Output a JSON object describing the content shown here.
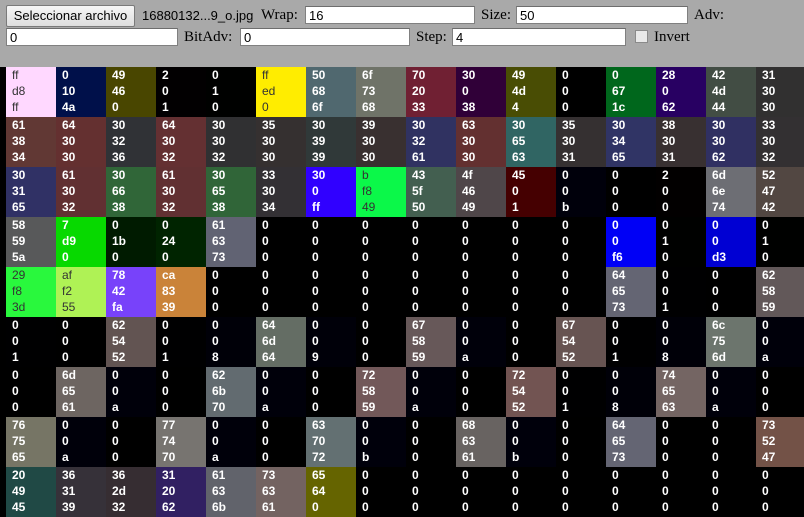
{
  "toolbar": {
    "file_button": "Seleccionar archivo",
    "file_name": "16880132...9_o.jpg",
    "wrap_label": "Wrap:",
    "wrap_value": "16",
    "size_label": "Size:",
    "size_value": "50",
    "adv_label": "Adv:",
    "adv_value": "0",
    "bitadv_label": "BitAdv:",
    "bitadv_value": "0",
    "step_label": "Step:",
    "step_value": "4",
    "invert_label": "Invert",
    "invert_checked": false
  },
  "grid": {
    "columns": 16,
    "cells": [
      {
        "r": "ff",
        "g": "d8",
        "b": "ff",
        "bg": "#ffd8ff"
      },
      {
        "r": "0",
        "g": "10",
        "b": "4a",
        "bg": "#00104a"
      },
      {
        "r": "49",
        "g": "46",
        "b": "0",
        "bg": "#494600"
      },
      {
        "r": "2",
        "g": "0",
        "b": "1",
        "bg": "#020001"
      },
      {
        "r": "0",
        "g": "1",
        "b": "0",
        "bg": "#000100"
      },
      {
        "r": "ff",
        "g": "ed",
        "b": "0",
        "bg": "#ffed00"
      },
      {
        "r": "50",
        "g": "68",
        "b": "6f",
        "bg": "#50686f"
      },
      {
        "r": "6f",
        "g": "73",
        "b": "68",
        "bg": "#6f7368"
      },
      {
        "r": "70",
        "g": "20",
        "b": "33",
        "bg": "#702033"
      },
      {
        "r": "30",
        "g": "0",
        "b": "38",
        "bg": "#300038"
      },
      {
        "r": "49",
        "g": "4d",
        "b": "4",
        "bg": "#494d04"
      },
      {
        "r": "0",
        "g": "0",
        "b": "0",
        "bg": "#000000"
      },
      {
        "r": "0",
        "g": "67",
        "b": "1c",
        "bg": "#00671c"
      },
      {
        "r": "28",
        "g": "0",
        "b": "62",
        "bg": "#280062"
      },
      {
        "r": "42",
        "g": "4d",
        "b": "44",
        "bg": "#424d44"
      },
      {
        "r": "31",
        "g": "30",
        "b": "30",
        "bg": "#313030"
      },
      {
        "r": "61",
        "g": "38",
        "b": "34",
        "bg": "#613834"
      },
      {
        "r": "64",
        "g": "30",
        "b": "30",
        "bg": "#643030"
      },
      {
        "r": "30",
        "g": "32",
        "b": "36",
        "bg": "#303236"
      },
      {
        "r": "64",
        "g": "30",
        "b": "32",
        "bg": "#643032"
      },
      {
        "r": "30",
        "g": "30",
        "b": "32",
        "bg": "#303032"
      },
      {
        "r": "35",
        "g": "30",
        "b": "30",
        "bg": "#353030"
      },
      {
        "r": "30",
        "g": "39",
        "b": "39",
        "bg": "#303939"
      },
      {
        "r": "39",
        "g": "30",
        "b": "30",
        "bg": "#393030"
      },
      {
        "r": "30",
        "g": "32",
        "b": "61",
        "bg": "#303261"
      },
      {
        "r": "63",
        "g": "30",
        "b": "30",
        "bg": "#633030"
      },
      {
        "r": "30",
        "g": "65",
        "b": "63",
        "bg": "#306563"
      },
      {
        "r": "35",
        "g": "30",
        "b": "31",
        "bg": "#353031"
      },
      {
        "r": "30",
        "g": "34",
        "b": "65",
        "bg": "#303465"
      },
      {
        "r": "38",
        "g": "30",
        "b": "31",
        "bg": "#383031"
      },
      {
        "r": "30",
        "g": "30",
        "b": "62",
        "bg": "#303062"
      },
      {
        "r": "33",
        "g": "30",
        "b": "32",
        "bg": "#333032"
      },
      {
        "r": "30",
        "g": "31",
        "b": "65",
        "bg": "#303165"
      },
      {
        "r": "61",
        "g": "30",
        "b": "32",
        "bg": "#613032"
      },
      {
        "r": "30",
        "g": "66",
        "b": "38",
        "bg": "#306638"
      },
      {
        "r": "61",
        "g": "30",
        "b": "32",
        "bg": "#613032"
      },
      {
        "r": "30",
        "g": "65",
        "b": "38",
        "bg": "#306538"
      },
      {
        "r": "33",
        "g": "30",
        "b": "34",
        "bg": "#333034"
      },
      {
        "r": "30",
        "g": "0",
        "b": "ff",
        "bg": "#3000ff"
      },
      {
        "r": "b",
        "g": "f8",
        "b": "49",
        "bg": "#0bf849"
      },
      {
        "r": "43",
        "g": "5f",
        "b": "50",
        "bg": "#435f50"
      },
      {
        "r": "4f",
        "g": "46",
        "b": "49",
        "bg": "#4f4649"
      },
      {
        "r": "45",
        "g": "0",
        "b": "1",
        "bg": "#450001"
      },
      {
        "r": "0",
        "g": "0",
        "b": "b",
        "bg": "#00000b"
      },
      {
        "r": "0",
        "g": "0",
        "b": "0",
        "bg": "#000000"
      },
      {
        "r": "2",
        "g": "0",
        "b": "0",
        "bg": "#020000"
      },
      {
        "r": "6d",
        "g": "6e",
        "b": "74",
        "bg": "#6d6e74"
      },
      {
        "r": "52",
        "g": "47",
        "b": "42",
        "bg": "#524742"
      },
      {
        "r": "58",
        "g": "59",
        "b": "5a",
        "bg": "#58595a"
      },
      {
        "r": "7",
        "g": "d9",
        "b": "0",
        "bg": "#07d900"
      },
      {
        "r": "0",
        "g": "1b",
        "b": "0",
        "bg": "#001b00"
      },
      {
        "r": "0",
        "g": "24",
        "b": "0",
        "bg": "#002400"
      },
      {
        "r": "61",
        "g": "63",
        "b": "73",
        "bg": "#616373"
      },
      {
        "r": "0",
        "g": "0",
        "b": "0",
        "bg": "#000000"
      },
      {
        "r": "0",
        "g": "0",
        "b": "0",
        "bg": "#000000"
      },
      {
        "r": "0",
        "g": "0",
        "b": "0",
        "bg": "#000000"
      },
      {
        "r": "0",
        "g": "0",
        "b": "0",
        "bg": "#000000"
      },
      {
        "r": "0",
        "g": "0",
        "b": "0",
        "bg": "#000000"
      },
      {
        "r": "0",
        "g": "0",
        "b": "0",
        "bg": "#000000"
      },
      {
        "r": "0",
        "g": "0",
        "b": "0",
        "bg": "#000000"
      },
      {
        "r": "0",
        "g": "0",
        "b": "f6",
        "bg": "#0000f6"
      },
      {
        "r": "0",
        "g": "1",
        "b": "0",
        "bg": "#000100"
      },
      {
        "r": "0",
        "g": "0",
        "b": "d3",
        "bg": "#0000d3"
      },
      {
        "r": "0",
        "g": "1",
        "b": "0",
        "bg": "#000100"
      },
      {
        "r": "29",
        "g": "f8",
        "b": "3d",
        "bg": "#29f83d"
      },
      {
        "r": "af",
        "g": "f2",
        "b": "55",
        "bg": "#aff255"
      },
      {
        "r": "78",
        "g": "42",
        "b": "fa",
        "bg": "#7842fa"
      },
      {
        "r": "ca",
        "g": "83",
        "b": "39",
        "bg": "#ca8339"
      },
      {
        "r": "0",
        "g": "0",
        "b": "0",
        "bg": "#000000"
      },
      {
        "r": "0",
        "g": "0",
        "b": "0",
        "bg": "#000000"
      },
      {
        "r": "0",
        "g": "0",
        "b": "0",
        "bg": "#000000"
      },
      {
        "r": "0",
        "g": "0",
        "b": "0",
        "bg": "#000000"
      },
      {
        "r": "0",
        "g": "0",
        "b": "0",
        "bg": "#000000"
      },
      {
        "r": "0",
        "g": "0",
        "b": "0",
        "bg": "#000000"
      },
      {
        "r": "0",
        "g": "0",
        "b": "0",
        "bg": "#000000"
      },
      {
        "r": "0",
        "g": "0",
        "b": "0",
        "bg": "#000000"
      },
      {
        "r": "64",
        "g": "65",
        "b": "73",
        "bg": "#646573"
      },
      {
        "r": "0",
        "g": "0",
        "b": "1",
        "bg": "#000001"
      },
      {
        "r": "0",
        "g": "0",
        "b": "0",
        "bg": "#000000"
      },
      {
        "r": "62",
        "g": "58",
        "b": "59",
        "bg": "#625859"
      },
      {
        "r": "0",
        "g": "0",
        "b": "1",
        "bg": "#000001"
      },
      {
        "r": "0",
        "g": "0",
        "b": "0",
        "bg": "#000000"
      },
      {
        "r": "62",
        "g": "54",
        "b": "52",
        "bg": "#625452"
      },
      {
        "r": "0",
        "g": "0",
        "b": "1",
        "bg": "#000001"
      },
      {
        "r": "0",
        "g": "0",
        "b": "8",
        "bg": "#000008"
      },
      {
        "r": "64",
        "g": "6d",
        "b": "64",
        "bg": "#646d64"
      },
      {
        "r": "0",
        "g": "0",
        "b": "9",
        "bg": "#000009"
      },
      {
        "r": "0",
        "g": "0",
        "b": "0",
        "bg": "#000000"
      },
      {
        "r": "67",
        "g": "58",
        "b": "59",
        "bg": "#675859"
      },
      {
        "r": "0",
        "g": "0",
        "b": "a",
        "bg": "#00000a"
      },
      {
        "r": "0",
        "g": "0",
        "b": "0",
        "bg": "#000000"
      },
      {
        "r": "67",
        "g": "54",
        "b": "52",
        "bg": "#675452"
      },
      {
        "r": "0",
        "g": "0",
        "b": "1",
        "bg": "#000001"
      },
      {
        "r": "0",
        "g": "0",
        "b": "8",
        "bg": "#000008"
      },
      {
        "r": "6c",
        "g": "75",
        "b": "6d",
        "bg": "#6c756d"
      },
      {
        "r": "0",
        "g": "0",
        "b": "a",
        "bg": "#00000a"
      },
      {
        "r": "0",
        "g": "0",
        "b": "0",
        "bg": "#000000"
      },
      {
        "r": "6d",
        "g": "65",
        "b": "61",
        "bg": "#6d6561"
      },
      {
        "r": "0",
        "g": "0",
        "b": "a",
        "bg": "#00000a"
      },
      {
        "r": "0",
        "g": "0",
        "b": "0",
        "bg": "#000000"
      },
      {
        "r": "62",
        "g": "6b",
        "b": "70",
        "bg": "#626b70"
      },
      {
        "r": "0",
        "g": "0",
        "b": "a",
        "bg": "#00000a"
      },
      {
        "r": "0",
        "g": "0",
        "b": "0",
        "bg": "#000000"
      },
      {
        "r": "72",
        "g": "58",
        "b": "59",
        "bg": "#725859"
      },
      {
        "r": "0",
        "g": "0",
        "b": "a",
        "bg": "#00000a"
      },
      {
        "r": "0",
        "g": "0",
        "b": "0",
        "bg": "#000000"
      },
      {
        "r": "72",
        "g": "54",
        "b": "52",
        "bg": "#725452"
      },
      {
        "r": "0",
        "g": "0",
        "b": "1",
        "bg": "#000001"
      },
      {
        "r": "0",
        "g": "0",
        "b": "8",
        "bg": "#000008"
      },
      {
        "r": "74",
        "g": "65",
        "b": "63",
        "bg": "#746563"
      },
      {
        "r": "0",
        "g": "0",
        "b": "a",
        "bg": "#00000a"
      },
      {
        "r": "0",
        "g": "0",
        "b": "0",
        "bg": "#000000"
      },
      {
        "r": "76",
        "g": "75",
        "b": "65",
        "bg": "#767565"
      },
      {
        "r": "0",
        "g": "0",
        "b": "a",
        "bg": "#00000a"
      },
      {
        "r": "0",
        "g": "0",
        "b": "0",
        "bg": "#000000"
      },
      {
        "r": "77",
        "g": "74",
        "b": "70",
        "bg": "#777470"
      },
      {
        "r": "0",
        "g": "0",
        "b": "a",
        "bg": "#00000a"
      },
      {
        "r": "0",
        "g": "0",
        "b": "0",
        "bg": "#000000"
      },
      {
        "r": "63",
        "g": "70",
        "b": "72",
        "bg": "#637072"
      },
      {
        "r": "0",
        "g": "0",
        "b": "b",
        "bg": "#00000b"
      },
      {
        "r": "0",
        "g": "0",
        "b": "0",
        "bg": "#000000"
      },
      {
        "r": "68",
        "g": "63",
        "b": "61",
        "bg": "#686361"
      },
      {
        "r": "0",
        "g": "0",
        "b": "b",
        "bg": "#00000b"
      },
      {
        "r": "0",
        "g": "0",
        "b": "0",
        "bg": "#000000"
      },
      {
        "r": "64",
        "g": "65",
        "b": "73",
        "bg": "#646573"
      },
      {
        "r": "0",
        "g": "0",
        "b": "0",
        "bg": "#000000"
      },
      {
        "r": "0",
        "g": "0",
        "b": "0",
        "bg": "#000000"
      },
      {
        "r": "73",
        "g": "52",
        "b": "47",
        "bg": "#735247"
      },
      {
        "r": "20",
        "g": "49",
        "b": "45",
        "bg": "#204945"
      },
      {
        "r": "36",
        "g": "31",
        "b": "39",
        "bg": "#363139"
      },
      {
        "r": "36",
        "g": "2d",
        "b": "32",
        "bg": "#362d32"
      },
      {
        "r": "31",
        "g": "20",
        "b": "62",
        "bg": "#312062"
      },
      {
        "r": "61",
        "g": "63",
        "b": "6b",
        "bg": "#61636b"
      },
      {
        "r": "73",
        "g": "63",
        "b": "61",
        "bg": "#736361"
      },
      {
        "r": "65",
        "g": "64",
        "b": "0",
        "bg": "#656400"
      },
      {
        "r": "0",
        "g": "0",
        "b": "0",
        "bg": "#000000"
      },
      {
        "r": "0",
        "g": "0",
        "b": "0",
        "bg": "#000000"
      },
      {
        "r": "0",
        "g": "0",
        "b": "0",
        "bg": "#000000"
      },
      {
        "r": "0",
        "g": "0",
        "b": "0",
        "bg": "#000000"
      },
      {
        "r": "0",
        "g": "0",
        "b": "0",
        "bg": "#000000"
      },
      {
        "r": "0",
        "g": "0",
        "b": "0",
        "bg": "#000000"
      },
      {
        "r": "0",
        "g": "0",
        "b": "0",
        "bg": "#000000"
      },
      {
        "r": "0",
        "g": "0",
        "b": "0",
        "bg": "#000000"
      },
      {
        "r": "0",
        "g": "0",
        "b": "0",
        "bg": "#000000"
      }
    ]
  }
}
